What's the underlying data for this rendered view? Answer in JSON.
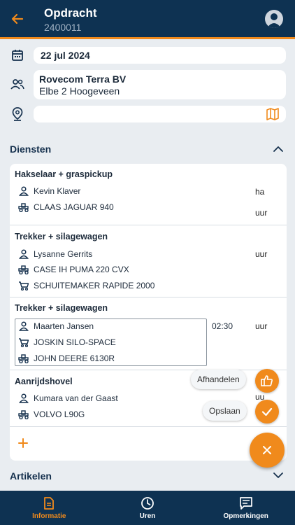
{
  "header": {
    "title": "Opdracht",
    "subtitle": "2400011"
  },
  "info": {
    "date": "22 jul 2024",
    "customer_name": "Rovecom Terra BV",
    "customer_address": "Elbe 2 Hoogeveen",
    "location": ""
  },
  "sections": {
    "services_title": "Diensten",
    "articles_title": "Artikelen"
  },
  "groups": [
    {
      "title": "Hakselaar + graspickup",
      "person": "Kevin Klaver",
      "vehicle": "CLAAS JAGUAR 940",
      "unit_top": "ha",
      "unit_bottom": "uur"
    },
    {
      "title": "Trekker + silagewagen",
      "person": "Lysanne Gerrits",
      "vehicle": "CASE IH PUMA 220 CVX",
      "trailer": "SCHUITEMAKER RAPIDE 2000",
      "unit": "uur"
    },
    {
      "title": "Trekker + silagewagen",
      "person": "Maarten Jansen",
      "trailer": "JOSKIN SILO-SPACE",
      "vehicle": "JOHN DEERE 6130R",
      "time": "02:30",
      "unit": "uur"
    },
    {
      "title": "Aanrijdshovel",
      "person": "Kumara van der Gaast",
      "vehicle": "VOLVO L90G",
      "unit": "uu"
    }
  ],
  "actions": {
    "complete_label": "Afhandelen",
    "save_label": "Opslaan"
  },
  "nav": {
    "info": "Informatie",
    "hours": "Uren",
    "remarks": "Opmerkingen"
  },
  "colors": {
    "header": "#0e3252",
    "accent": "#f08a1c",
    "background": "#e9edf1"
  }
}
